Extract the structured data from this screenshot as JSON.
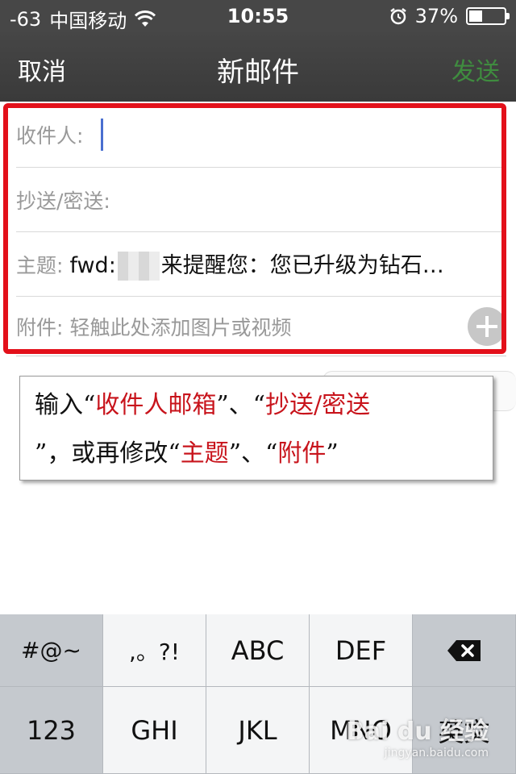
{
  "status_bar": {
    "signal": "-63",
    "carrier": "中国移动",
    "time": "10:55",
    "battery_percent": "37%",
    "battery_level": 0.37
  },
  "nav": {
    "cancel_label": "取消",
    "title": "新邮件",
    "send_label": "发送",
    "send_color": "#3f8c3f"
  },
  "form": {
    "to_label": "收件人:",
    "cc_label": "抄送/密送:",
    "subject_label": "主题:",
    "subject_prefix": "fwd:",
    "subject_rest": "来提醒您：您已升级为钻石…",
    "attach_label": "附件:",
    "attach_hint": "轻触此处添加图片或视频"
  },
  "callout": {
    "t1": "输入“",
    "r1": "收件人邮箱",
    "t2": "”、“",
    "r2": "抄送/密送",
    "t3": "”，或再修改“",
    "r3": "主题",
    "t4": "”、“",
    "r4": "附件",
    "t5": "”",
    "highlight_color": "#c8141c",
    "frame_color": "#e3101a"
  },
  "keyboard": {
    "row1": [
      "#@~",
      ",。?!",
      "ABC",
      "DEF"
    ],
    "row2": [
      "123",
      "GHI",
      "JKL",
      "MNO",
      "英文"
    ]
  },
  "watermark": {
    "brand": "Bai du 经验",
    "url": "jingyan.baidu.com"
  },
  "icons": {
    "wifi": "wifi-icon",
    "alarm": "alarm-icon",
    "battery": "battery-icon",
    "add": "plus-circle-icon",
    "backspace": "backspace-icon"
  }
}
